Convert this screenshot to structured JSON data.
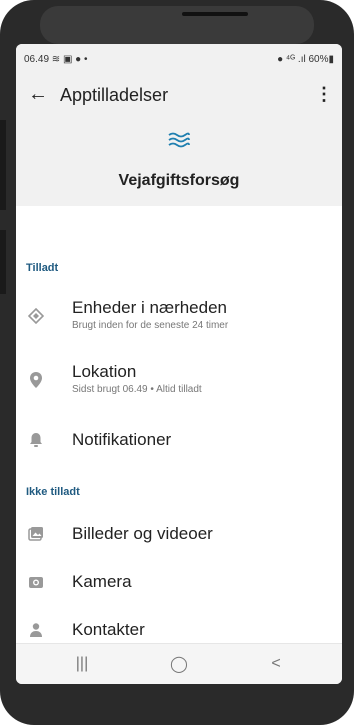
{
  "status_bar": {
    "left": "06.49 ≋ ▣ ● •",
    "right": "● ⁴ᴳ .ıl 60%▮"
  },
  "app_bar": {
    "back_icon": "arrow-left-icon",
    "title": "Apptilladelser",
    "menu_icon": "more-vert-icon"
  },
  "header": {
    "app_icon": "wave-icon",
    "app_name": "Vejafgiftsforsøg"
  },
  "sections": {
    "allowed": "Tilladt",
    "not_allowed": "Ikke tilladt"
  },
  "permissions": {
    "nearby": {
      "label": "Enheder i nærheden",
      "sub": "Brugt inden for de seneste 24 timer",
      "icon": "nearby-devices-icon"
    },
    "location": {
      "label": "Lokation",
      "sub": "Sidst brugt 06.49 • Altid tilladt",
      "icon": "location-pin-icon"
    },
    "notifications": {
      "label": "Notifikationer",
      "icon": "bell-icon"
    },
    "photos": {
      "label": "Billeder og videoer",
      "icon": "photos-icon"
    },
    "camera": {
      "label": "Kamera",
      "icon": "camera-icon"
    },
    "contacts": {
      "label": "Kontakter",
      "icon": "person-icon"
    }
  },
  "nav_bar": {
    "recents": "|||",
    "home": "◯",
    "back": "<"
  },
  "colors": {
    "accent": "#1f5a80",
    "icon_gray": "#999999",
    "surface": "#f1f1f1"
  }
}
